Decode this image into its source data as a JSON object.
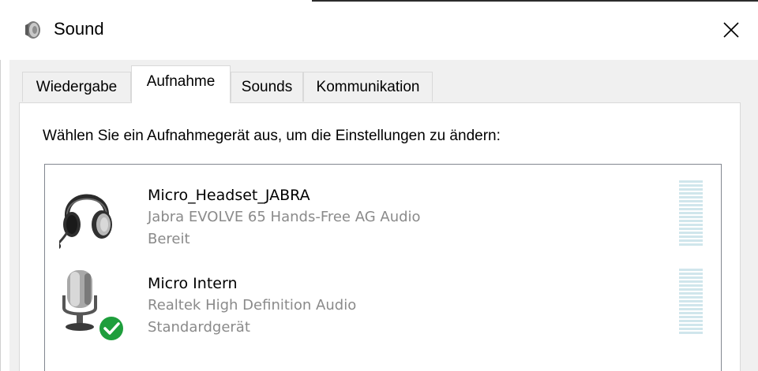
{
  "window": {
    "title": "Sound",
    "icon": "speaker-icon",
    "close_icon": "close-icon"
  },
  "tabs": [
    {
      "label": "Wiedergabe",
      "active": false
    },
    {
      "label": "Aufnahme",
      "active": true
    },
    {
      "label": "Sounds",
      "active": false
    },
    {
      "label": "Kommunikation",
      "active": false
    }
  ],
  "panel": {
    "instruction": "Wählen Sie ein Aufnahmegerät aus, um die Einstellungen zu ändern:"
  },
  "devices": [
    {
      "name": "Micro_Headset_JABRA",
      "driver": "Jabra EVOLVE 65 Hands-Free AG Audio",
      "status": "Bereit",
      "icon": "headset-icon",
      "default": false,
      "level": 0
    },
    {
      "name": "Micro Intern",
      "driver": "Realtek High Definition Audio",
      "status": "Standardgerät",
      "icon": "microphone-icon",
      "default": true,
      "default_badge_icon": "green-checkmark-icon",
      "level": 0
    }
  ],
  "colors": {
    "meter_bar": "#d0e6ec",
    "default_badge": "#1e9e3c",
    "secondary_text": "#8a8a8a",
    "dialog_background": "#f0f0f0"
  }
}
